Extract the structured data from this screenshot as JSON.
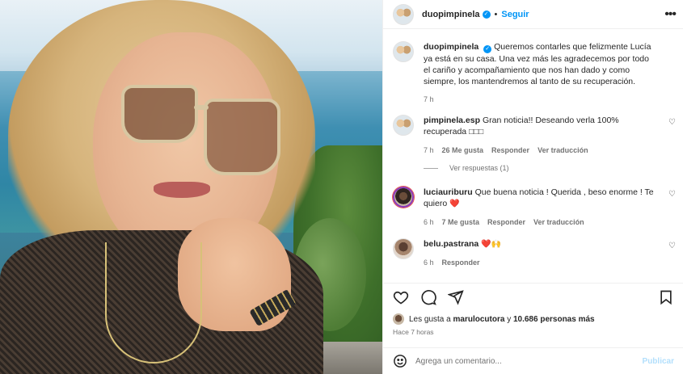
{
  "post": {
    "author": "duopimpinela",
    "follow_label": "Seguir",
    "separator": "•",
    "caption": "Queremos contarles que felizmente Lucía ya está en su casa. Una vez más les agradecemos por todo el cariño y acompañamiento que nos han dado y como siempre, los mantendremos al tanto de su recuperación.",
    "caption_time": "7 h"
  },
  "comments": [
    {
      "user": "pimpinela.esp",
      "text": "Gran noticia!! Deseando verla 100% recuperada",
      "emoji": "□□□",
      "time": "7 h",
      "likes": "26 Me gusta",
      "reply": "Responder",
      "translate": "Ver traducción"
    },
    {
      "user": "luciauriburu",
      "text": "Que buena noticia ! Querida , beso enorme ! Te quiero",
      "emoji": "❤️",
      "time": "6 h",
      "likes": "7 Me gusta",
      "reply": "Responder",
      "translate": "Ver traducción"
    },
    {
      "user": "belu.pastrana",
      "text": "",
      "emoji": "❤️🙌",
      "time": "6 h",
      "reply": "Responder"
    }
  ],
  "view_replies": "Ver respuestas (1)",
  "likes_summary": {
    "prefix": "Les gusta a",
    "user": "marulocutora",
    "conj": "y",
    "others": "10.686 personas más"
  },
  "post_time": "Hace 7 horas",
  "composer": {
    "placeholder": "Agrega un comentario...",
    "publish_label": "Publicar"
  },
  "colors": {
    "accent": "#0095f6",
    "publish_disabled": "#b2dffc",
    "muted": "#737373"
  }
}
